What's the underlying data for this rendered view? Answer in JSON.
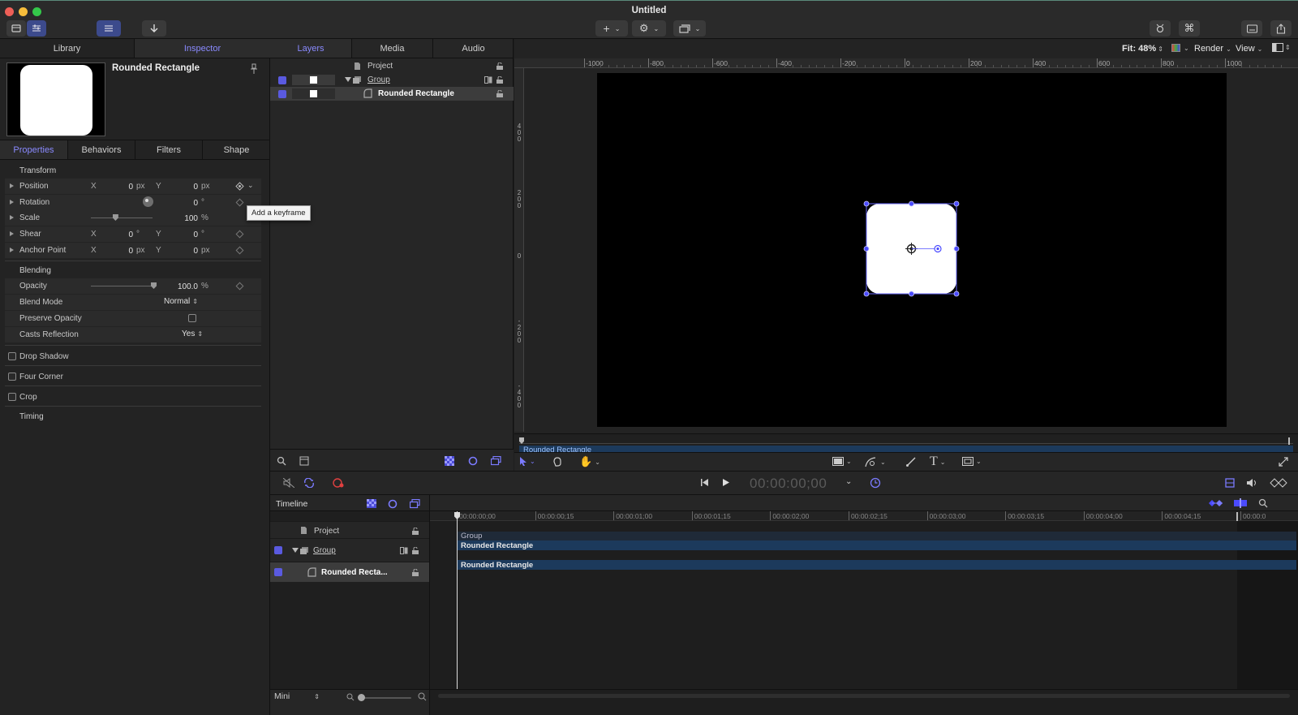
{
  "window": {
    "title": "Untitled",
    "traffic_colors": [
      "#ee5f57",
      "#f6bd3b",
      "#34c84a"
    ]
  },
  "left_panel": {
    "tabs": [
      "Library",
      "Inspector"
    ],
    "active_tab": "Inspector",
    "layer_name": "Rounded Rectangle",
    "subtabs": [
      "Properties",
      "Behaviors",
      "Filters",
      "Shape"
    ],
    "active_subtab": "Properties",
    "transform_header": "Transform",
    "blending_header": "Blending",
    "transform": {
      "position": {
        "label": "Position",
        "x_label": "X",
        "x": "0",
        "x_unit": "px",
        "y_label": "Y",
        "y": "0",
        "y_unit": "px"
      },
      "rotation": {
        "label": "Rotation",
        "value": "0",
        "unit": "°"
      },
      "scale": {
        "label": "Scale",
        "value": "100",
        "unit": "%",
        "slider": 0.4
      },
      "shear": {
        "label": "Shear",
        "x_label": "X",
        "x": "0",
        "x_unit": "°",
        "y_label": "Y",
        "y": "0",
        "y_unit": "°"
      },
      "anchor": {
        "label": "Anchor Point",
        "x_label": "X",
        "x": "0",
        "x_unit": "px",
        "y_label": "Y",
        "y": "0",
        "y_unit": "px"
      }
    },
    "blending": {
      "opacity": {
        "label": "Opacity",
        "value": "100.0",
        "unit": "%",
        "slider": 1.0
      },
      "blend_mode": {
        "label": "Blend Mode",
        "value": "Normal"
      },
      "preserve_opacity": {
        "label": "Preserve Opacity",
        "checked": false
      },
      "casts_reflection": {
        "label": "Casts Reflection",
        "value": "Yes"
      }
    },
    "sections": [
      {
        "label": "Drop Shadow",
        "checked": false
      },
      {
        "label": "Four Corner",
        "checked": false
      },
      {
        "label": "Crop",
        "checked": false
      }
    ],
    "timing_header": "Timing",
    "tooltip": "Add a keyframe"
  },
  "layers_panel": {
    "tabs": [
      "Layers",
      "Media",
      "Audio"
    ],
    "active_tab": "Layers",
    "rows": [
      {
        "name": "Project",
        "level": 0
      },
      {
        "name": "Group",
        "level": 1,
        "checked": true
      },
      {
        "name": "Rounded Rectangle",
        "level": 2,
        "checked": true,
        "selected": true
      }
    ]
  },
  "viewer": {
    "fit_label": "Fit: 48%",
    "render_label": "Render",
    "view_label": "View",
    "ruler_ticks": [
      "-1000",
      "-800",
      "-600",
      "-400",
      "-200",
      "0",
      "200",
      "400",
      "600",
      "800",
      "1000"
    ],
    "vruler_ticks": [
      "4\n0\n0",
      "2\n0\n0",
      "0",
      "-\n2\n0\n0",
      "-\n4\n0\n0"
    ],
    "mini_timeline_label": "Rounded Rectangle"
  },
  "transport": {
    "timecode": "00:00:00;00"
  },
  "timeline": {
    "title": "Timeline",
    "ruler": [
      "00:00:00;00",
      "00:00:00;15",
      "00:00:01;00",
      "00:00:01;15",
      "00:00:02;00",
      "00:00:02;15",
      "00:00:03;00",
      "00:00:03;15",
      "00:00:04;00",
      "00:00:04;15",
      "00:00:0"
    ],
    "rows": [
      {
        "name": "Project"
      },
      {
        "name": "Group",
        "checked": true
      },
      {
        "name": "Rounded Recta...",
        "checked": true,
        "selected": true
      }
    ],
    "tracks": {
      "group_label": "Group",
      "group_bar": "Rounded Rectangle",
      "layer_bar": "Rounded Rectangle"
    },
    "zoom_mode": "Mini"
  },
  "colors": {
    "accent": "#7b7bff",
    "selection_bar": "#1c3a5c"
  }
}
